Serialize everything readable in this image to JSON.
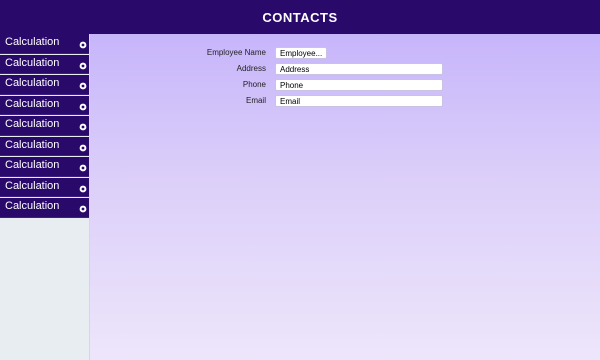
{
  "header": {
    "title": "CONTACTS"
  },
  "sidebar": {
    "items": [
      {
        "label": "Calculation",
        "icon": "eye-icon"
      },
      {
        "label": "Calculation",
        "icon": "eye-icon"
      },
      {
        "label": "Calculation",
        "icon": "eye-icon"
      },
      {
        "label": "Calculation",
        "icon": "eye-icon"
      },
      {
        "label": "Calculation",
        "icon": "eye-icon"
      },
      {
        "label": "Calculation",
        "icon": "eye-icon"
      },
      {
        "label": "Calculation",
        "icon": "eye-icon"
      },
      {
        "label": "Calculation",
        "icon": "eye-icon"
      },
      {
        "label": "Calculation",
        "icon": "eye-icon"
      }
    ]
  },
  "form": {
    "employee_name": {
      "label": "Employee Name",
      "value": "Employee..."
    },
    "address": {
      "label": "Address",
      "value": "Address"
    },
    "phone": {
      "label": "Phone",
      "value": "Phone"
    },
    "email": {
      "label": "Email",
      "value": "Email"
    }
  },
  "colors": {
    "header_bg": "#290a6b",
    "sidebar_item_bg": "#290a6b",
    "sidebar_bg": "#e8edf1",
    "main_gradient_top": "#c7b5fb",
    "main_gradient_bottom": "#ede6fb"
  }
}
